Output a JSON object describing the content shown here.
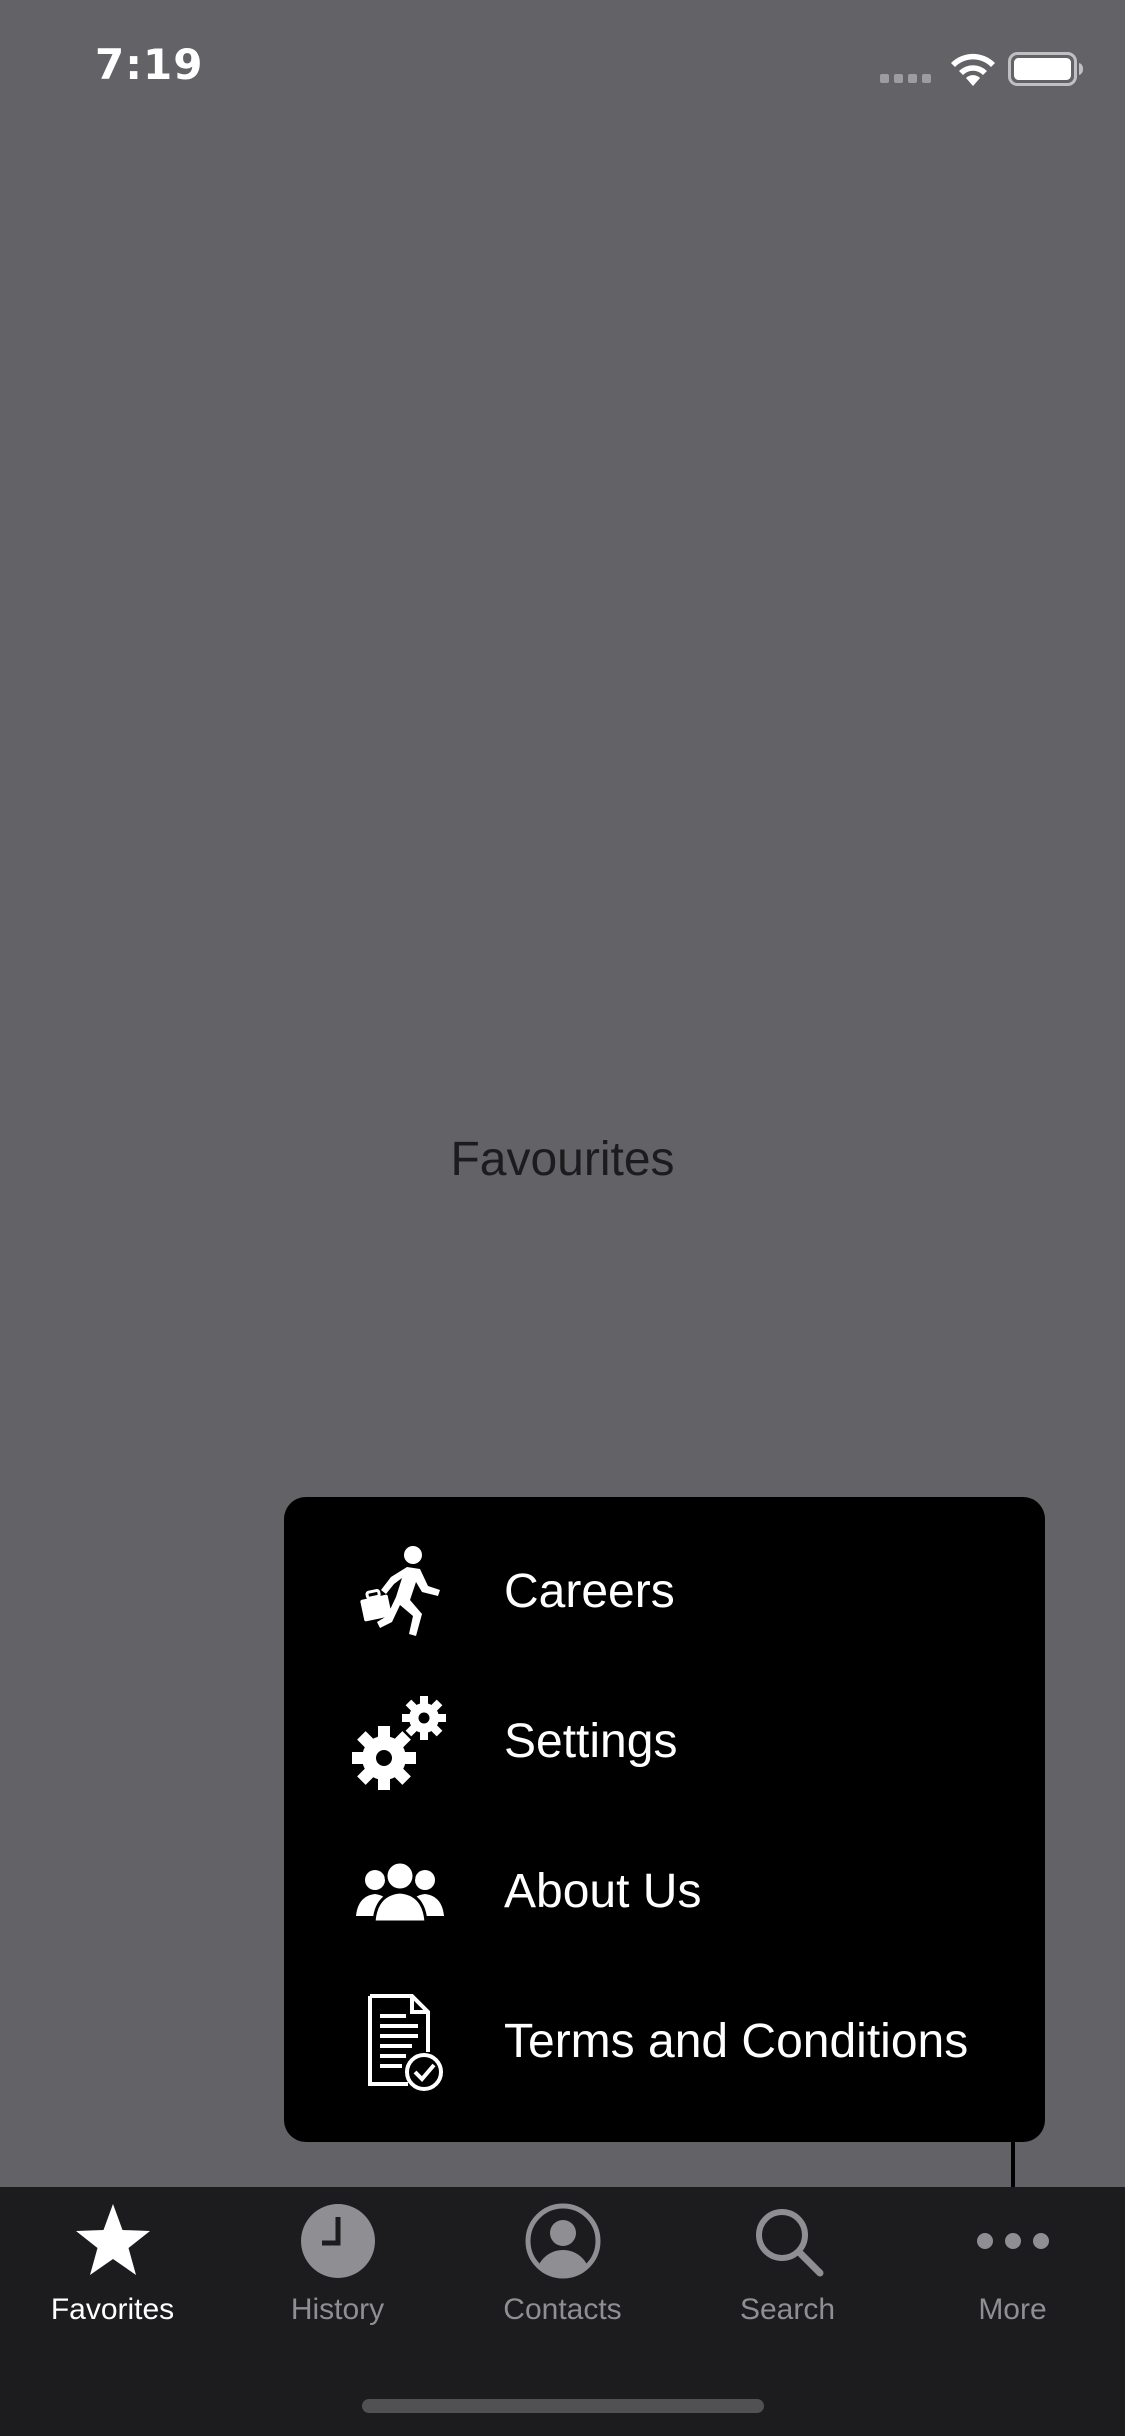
{
  "status_bar": {
    "time": "7:19",
    "signal_icon": "cellular-signal-icon",
    "wifi_icon": "wifi-icon",
    "battery_icon": "battery-icon"
  },
  "screen": {
    "title": "Favourites",
    "background_color": "#636266"
  },
  "popup_menu": {
    "items": [
      {
        "label": "Careers",
        "icon": "careers-icon"
      },
      {
        "label": "Settings",
        "icon": "settings-gears-icon"
      },
      {
        "label": "About Us",
        "icon": "about-us-people-icon"
      },
      {
        "label": "Terms and Conditions",
        "icon": "terms-document-icon"
      }
    ]
  },
  "tab_bar": {
    "selected": "Favorites",
    "tabs": [
      {
        "label": "Favorites",
        "icon": "star-icon"
      },
      {
        "label": "History",
        "icon": "clock-icon"
      },
      {
        "label": "Contacts",
        "icon": "person-circle-icon"
      },
      {
        "label": "Search",
        "icon": "search-icon"
      },
      {
        "label": "More",
        "icon": "more-dots-icon"
      }
    ]
  }
}
